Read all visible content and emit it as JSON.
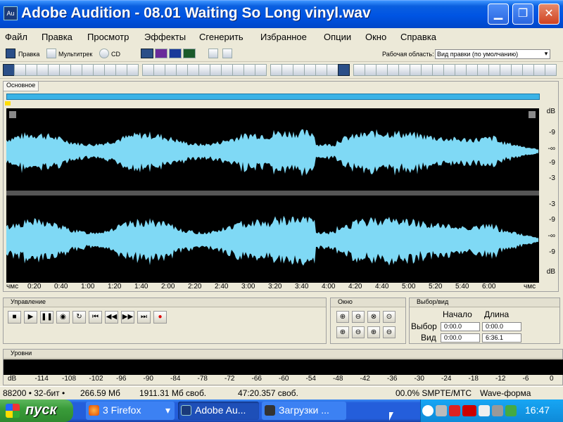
{
  "window": {
    "title": "Adobe Audition - 08.01 Waiting So Long vinyl.wav",
    "icon_text": "Au"
  },
  "menu": [
    "Файл",
    "Правка",
    "Просмотр",
    "Эффекты",
    "Сгенерить",
    "Избранное",
    "Опции",
    "Окно",
    "Справка"
  ],
  "toolbar1": {
    "edit": "Правка",
    "multitrack": "Мультитрек",
    "cd": "CD",
    "workspace_label": "Рабочая область:",
    "workspace_value": "Вид правки (по умолчанию)"
  },
  "main_panel": {
    "tab": "Основное",
    "time_unit": "чмс",
    "time_ticks": [
      "0:20",
      "0:40",
      "1:00",
      "1:20",
      "1:40",
      "2:00",
      "2:20",
      "2:40",
      "3:00",
      "3:20",
      "3:40",
      "4:00",
      "4:20",
      "4:40",
      "5:00",
      "5:20",
      "5:40",
      "6:00"
    ],
    "time_end": "чмс",
    "db_labels": [
      "dB",
      "-9",
      "-∞",
      "-9",
      "-3",
      "-3",
      "-9",
      "-∞",
      "-9",
      "dB"
    ]
  },
  "transport": {
    "title": "Управление"
  },
  "zoom": {
    "title": "Окно"
  },
  "selview": {
    "title": "Выбор/вид",
    "start_label": "Начало",
    "length_label": "Длина",
    "selection_label": "Выбор",
    "view_label": "Вид",
    "sel_start": "0:00.0",
    "sel_length": "0:00.0",
    "view_start": "0:00.0",
    "view_length": "6:36.1"
  },
  "levels": {
    "title": "Уровни",
    "ticks": [
      "dB",
      "-114",
      "-108",
      "-102",
      "-96",
      "-90",
      "-84",
      "-78",
      "-72",
      "-66",
      "-60",
      "-54",
      "-48",
      "-42",
      "-36",
      "-30",
      "-24",
      "-18",
      "-12",
      "-6",
      "0"
    ]
  },
  "status": {
    "format": "88200 • 32-бит •",
    "size": "266.59 Мб",
    "free": "1911.31 Мб своб.",
    "time_free": "47:20.357 своб.",
    "smpte": "00.0% SMPTE/MTC",
    "view": "Wave-форма"
  },
  "taskbar": {
    "start": "пуск",
    "tasks": [
      "3 Firefox",
      "Adobe Au...",
      "Загрузки ..."
    ],
    "clock": "16:47"
  },
  "colors": {
    "waveform": "#7fd9f5",
    "overview": "#3bb3e6"
  }
}
